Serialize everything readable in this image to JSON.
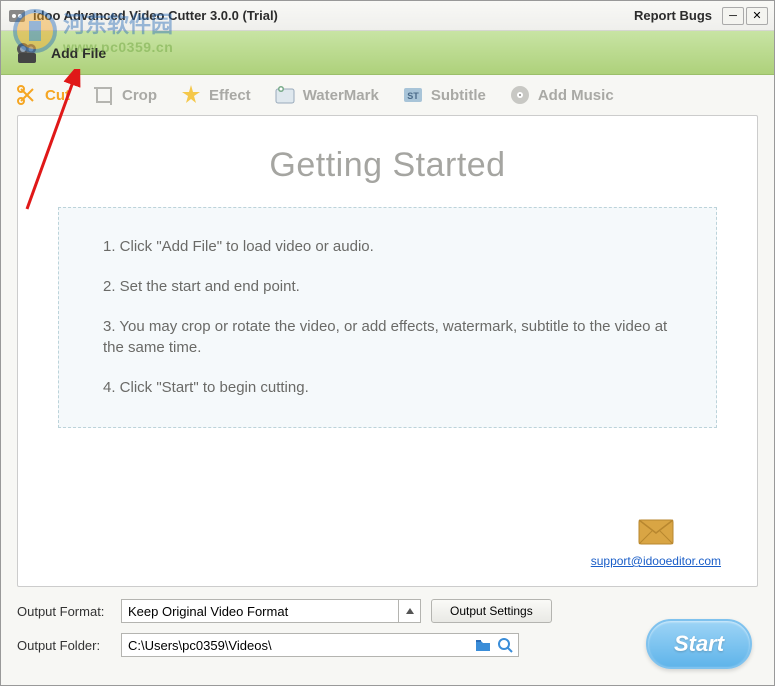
{
  "titlebar": {
    "title": "idoo Advanced Video Cutter 3.0.0 (Trial)",
    "report_link": "Report Bugs"
  },
  "addfile": {
    "label": "Add File"
  },
  "toolbar": {
    "cut": "Cut",
    "crop": "Crop",
    "effect": "Effect",
    "watermark": "WaterMark",
    "subtitle": "Subtitle",
    "addmusic": "Add Music"
  },
  "getting_started": {
    "title": "Getting Started",
    "steps": [
      "1. Click \"Add File\" to load video or audio.",
      "2. Set the start and end point.",
      "3. You may crop or rotate the video, or add effects, watermark, subtitle to the video at the same time.",
      "4. Click \"Start\" to begin cutting."
    ]
  },
  "support": {
    "email": "support@idooeditor.com"
  },
  "output": {
    "format_label": "Output Format:",
    "format_value": "Keep Original Video Format",
    "settings_btn": "Output Settings",
    "folder_label": "Output Folder:",
    "folder_value": "C:\\Users\\pc0359\\Videos\\"
  },
  "start_button": "Start",
  "watermark": {
    "cn": "河东软件园",
    "url": "www.pc0359.cn"
  }
}
